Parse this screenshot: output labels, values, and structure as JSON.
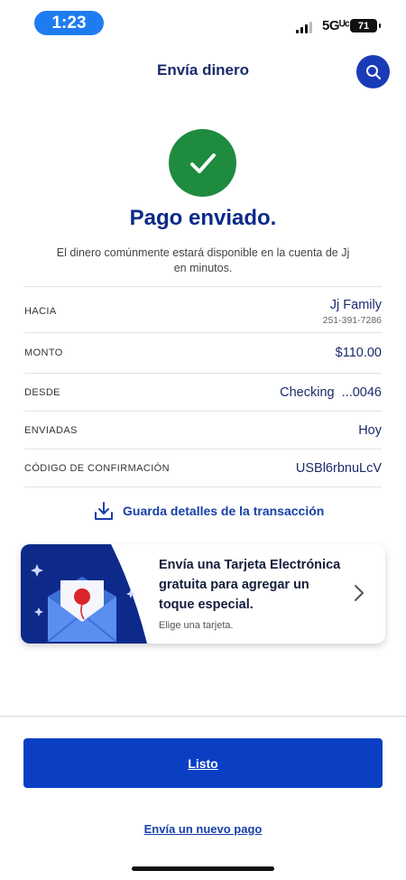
{
  "status_bar": {
    "time": "1:23",
    "network": "5Gᵁᶜ",
    "battery": "71"
  },
  "header": {
    "title": "Envía dinero",
    "search_icon": "search-icon"
  },
  "success": {
    "icon": "check-icon",
    "title": "Pago enviado.",
    "subtitle": "El dinero comúnmente estará disponible en la cuenta de Jj en minutos."
  },
  "details": {
    "to_label": "HACIA",
    "to_name": "Jj Family",
    "to_phone": "251-391-7286",
    "amount_label": "MONTO",
    "amount_value": "$110.00",
    "from_label": "DESDE",
    "from_value": "Checking  ...0046",
    "sent_label": "ENVIADAS",
    "sent_value": "Hoy",
    "confirmation_label": "CÓDIGO DE CONFIRMACIÓN",
    "confirmation_value": "USBl6rbnuLcV"
  },
  "save_details": {
    "icon": "download-icon",
    "label": "Guarda detalles de la transacción"
  },
  "ecard": {
    "title": "Envía una Tarjeta Electrónica gratuita para agregar un toque especial.",
    "subtitle": "Elige una tarjeta.",
    "icon": "envelope-balloon-icon"
  },
  "actions": {
    "done_label": "Listo",
    "new_payment_label": "Envía un nuevo pago"
  },
  "colors": {
    "brand_blue": "#0a3fc4",
    "navy": "#1b2a6b",
    "success_green": "#1e8b3f"
  }
}
